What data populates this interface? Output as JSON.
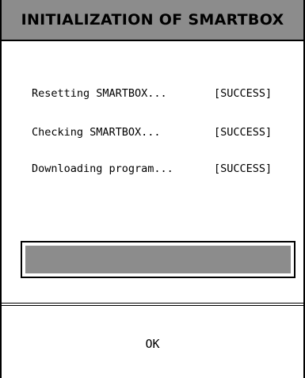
{
  "dialog": {
    "title": "INITIALIZATION OF SMARTBOX",
    "status_rows": [
      {
        "label": "Resetting SMARTBOX...",
        "result": "[SUCCESS]"
      },
      {
        "label": "Checking SMARTBOX...",
        "result": "[SUCCESS]"
      },
      {
        "label": "Downloading program...",
        "result": "[SUCCESS]"
      }
    ],
    "progress": {
      "fraction": 1.0
    },
    "ok_label": "OK"
  },
  "colors": {
    "title_bar": "#8c8c8c",
    "progress_fill": "#8c8c8c",
    "border": "#000000",
    "background": "#ffffff"
  }
}
